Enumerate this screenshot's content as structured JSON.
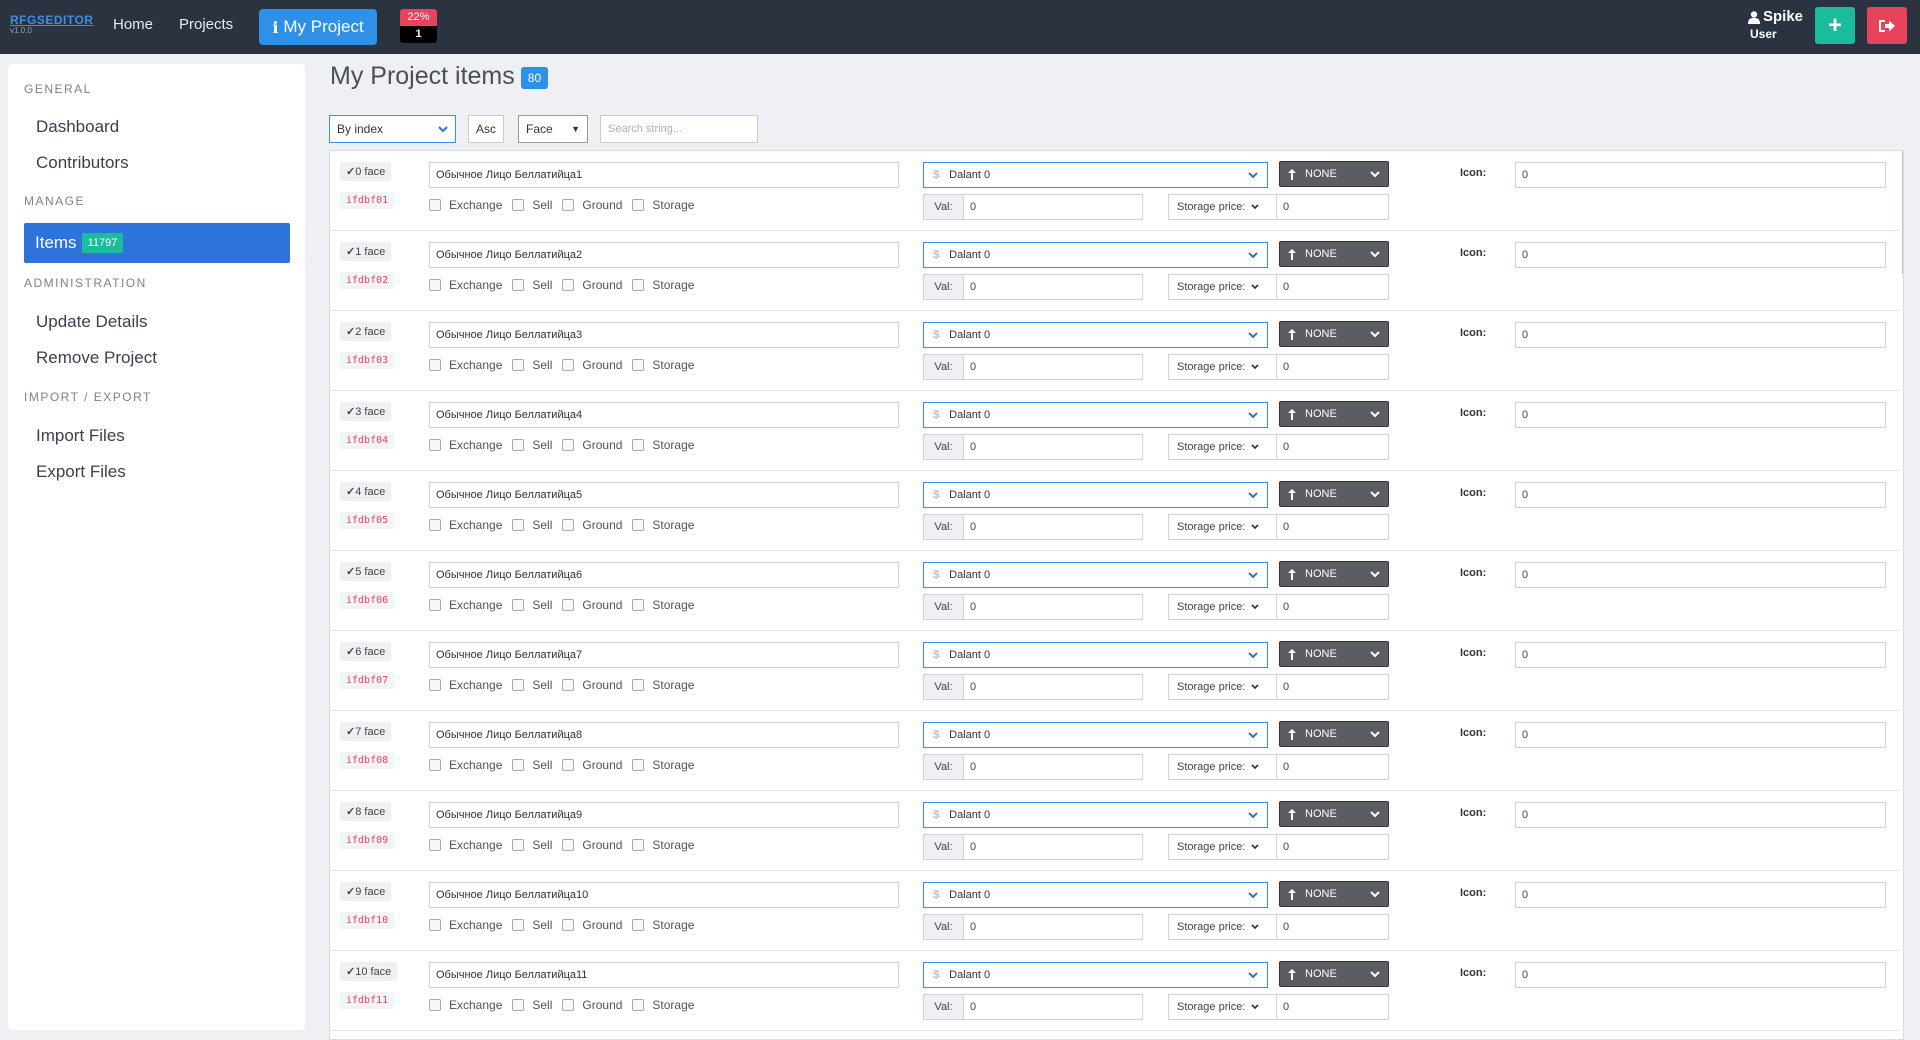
{
  "app": {
    "brand": "RFGSEDITOR",
    "version": "v1.0.0"
  },
  "nav": {
    "home": "Home",
    "projects": "Projects",
    "my_project": "My Project",
    "progress_percent": "22%",
    "progress_count": "1"
  },
  "user": {
    "name": "Spike",
    "role": "User"
  },
  "sidebar": {
    "general_header": "GENERAL",
    "dashboard": "Dashboard",
    "contributors": "Contributors",
    "manage_header": "MANAGE",
    "items_label": "Items",
    "items_count": "11797",
    "admin_header": "ADMINISTRATION",
    "update_details": "Update Details",
    "remove_project": "Remove Project",
    "io_header": "IMPORT / EXPORT",
    "import_files": "Import Files",
    "export_files": "Export Files"
  },
  "page": {
    "title": "My Project items",
    "count": "80"
  },
  "controls": {
    "sort_value": "By index",
    "order_value": "Asc",
    "type_value": "Face",
    "search_placeholder": "Search string..."
  },
  "labels": {
    "exchange": "Exchange",
    "sell": "Sell",
    "ground": "Ground",
    "storage": "Storage",
    "val": "Val:",
    "storage_price": "Storage price:",
    "none": "NONE",
    "icon": "Icon:"
  },
  "items": [
    {
      "face": "0 face",
      "code": "ifdbf01",
      "name": "Обычное Лицо Беллатийца1",
      "currency": "Dalant 0",
      "val": "0",
      "storage_price": "0",
      "icon": "0"
    },
    {
      "face": "1 face",
      "code": "ifdbf02",
      "name": "Обычное Лицо Беллатийца2",
      "currency": "Dalant 0",
      "val": "0",
      "storage_price": "0",
      "icon": "0"
    },
    {
      "face": "2 face",
      "code": "ifdbf03",
      "name": "Обычное Лицо Беллатийца3",
      "currency": "Dalant 0",
      "val": "0",
      "storage_price": "0",
      "icon": "0"
    },
    {
      "face": "3 face",
      "code": "ifdbf04",
      "name": "Обычное Лицо Беллатийца4",
      "currency": "Dalant 0",
      "val": "0",
      "storage_price": "0",
      "icon": "0"
    },
    {
      "face": "4 face",
      "code": "ifdbf05",
      "name": "Обычное Лицо Беллатийца5",
      "currency": "Dalant 0",
      "val": "0",
      "storage_price": "0",
      "icon": "0"
    },
    {
      "face": "5 face",
      "code": "ifdbf06",
      "name": "Обычное Лицо Беллатийца6",
      "currency": "Dalant 0",
      "val": "0",
      "storage_price": "0",
      "icon": "0"
    },
    {
      "face": "6 face",
      "code": "ifdbf07",
      "name": "Обычное Лицо Беллатийца7",
      "currency": "Dalant 0",
      "val": "0",
      "storage_price": "0",
      "icon": "0"
    },
    {
      "face": "7 face",
      "code": "ifdbf08",
      "name": "Обычное Лицо Беллатийца8",
      "currency": "Dalant 0",
      "val": "0",
      "storage_price": "0",
      "icon": "0"
    },
    {
      "face": "8 face",
      "code": "ifdbf09",
      "name": "Обычное Лицо Беллатийца9",
      "currency": "Dalant 0",
      "val": "0",
      "storage_price": "0",
      "icon": "0"
    },
    {
      "face": "9 face",
      "code": "ifdbf10",
      "name": "Обычное Лицо Беллатийца10",
      "currency": "Dalant 0",
      "val": "0",
      "storage_price": "0",
      "icon": "0"
    },
    {
      "face": "10 face",
      "code": "ifdbf11",
      "name": "Обычное Лицо Беллатийца11",
      "currency": "Dalant 0",
      "val": "0",
      "storage_price": "0",
      "icon": "0"
    }
  ]
}
